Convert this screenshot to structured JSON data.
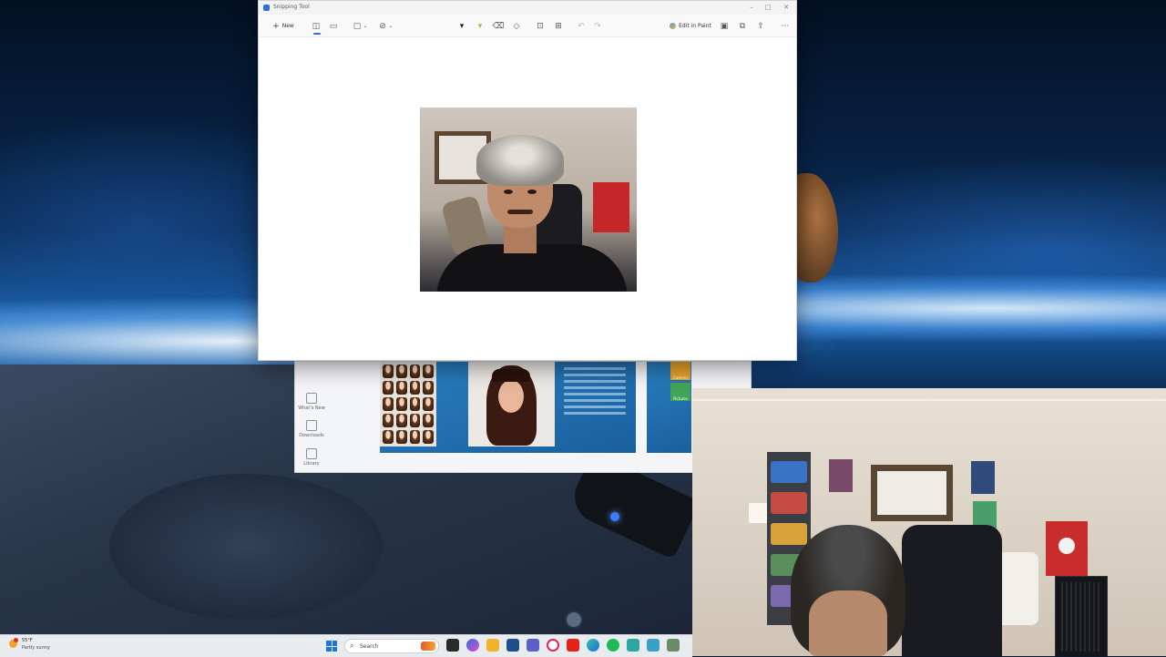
{
  "snipping_tool": {
    "title": "Snipping Tool",
    "new_label": "New",
    "edit_in_paint_label": "Edit in Paint",
    "more_icon": "⋯"
  },
  "background_app": {
    "sidebar": [
      {
        "label": "What's New",
        "icon": "sparkle-icon"
      },
      {
        "label": "Downloads",
        "icon": "cloud-download-icon"
      },
      {
        "label": "Library",
        "icon": "library-icon"
      }
    ],
    "tiles": [
      {
        "label": "Camera"
      },
      {
        "label": "Pictures"
      }
    ]
  },
  "taskbar": {
    "weather_temp": "55°F",
    "weather_condition": "Partly sunny",
    "search_placeholder": "Search"
  },
  "colors": {
    "accent": "#2f6fd6",
    "start_button": "#1f74d8"
  }
}
